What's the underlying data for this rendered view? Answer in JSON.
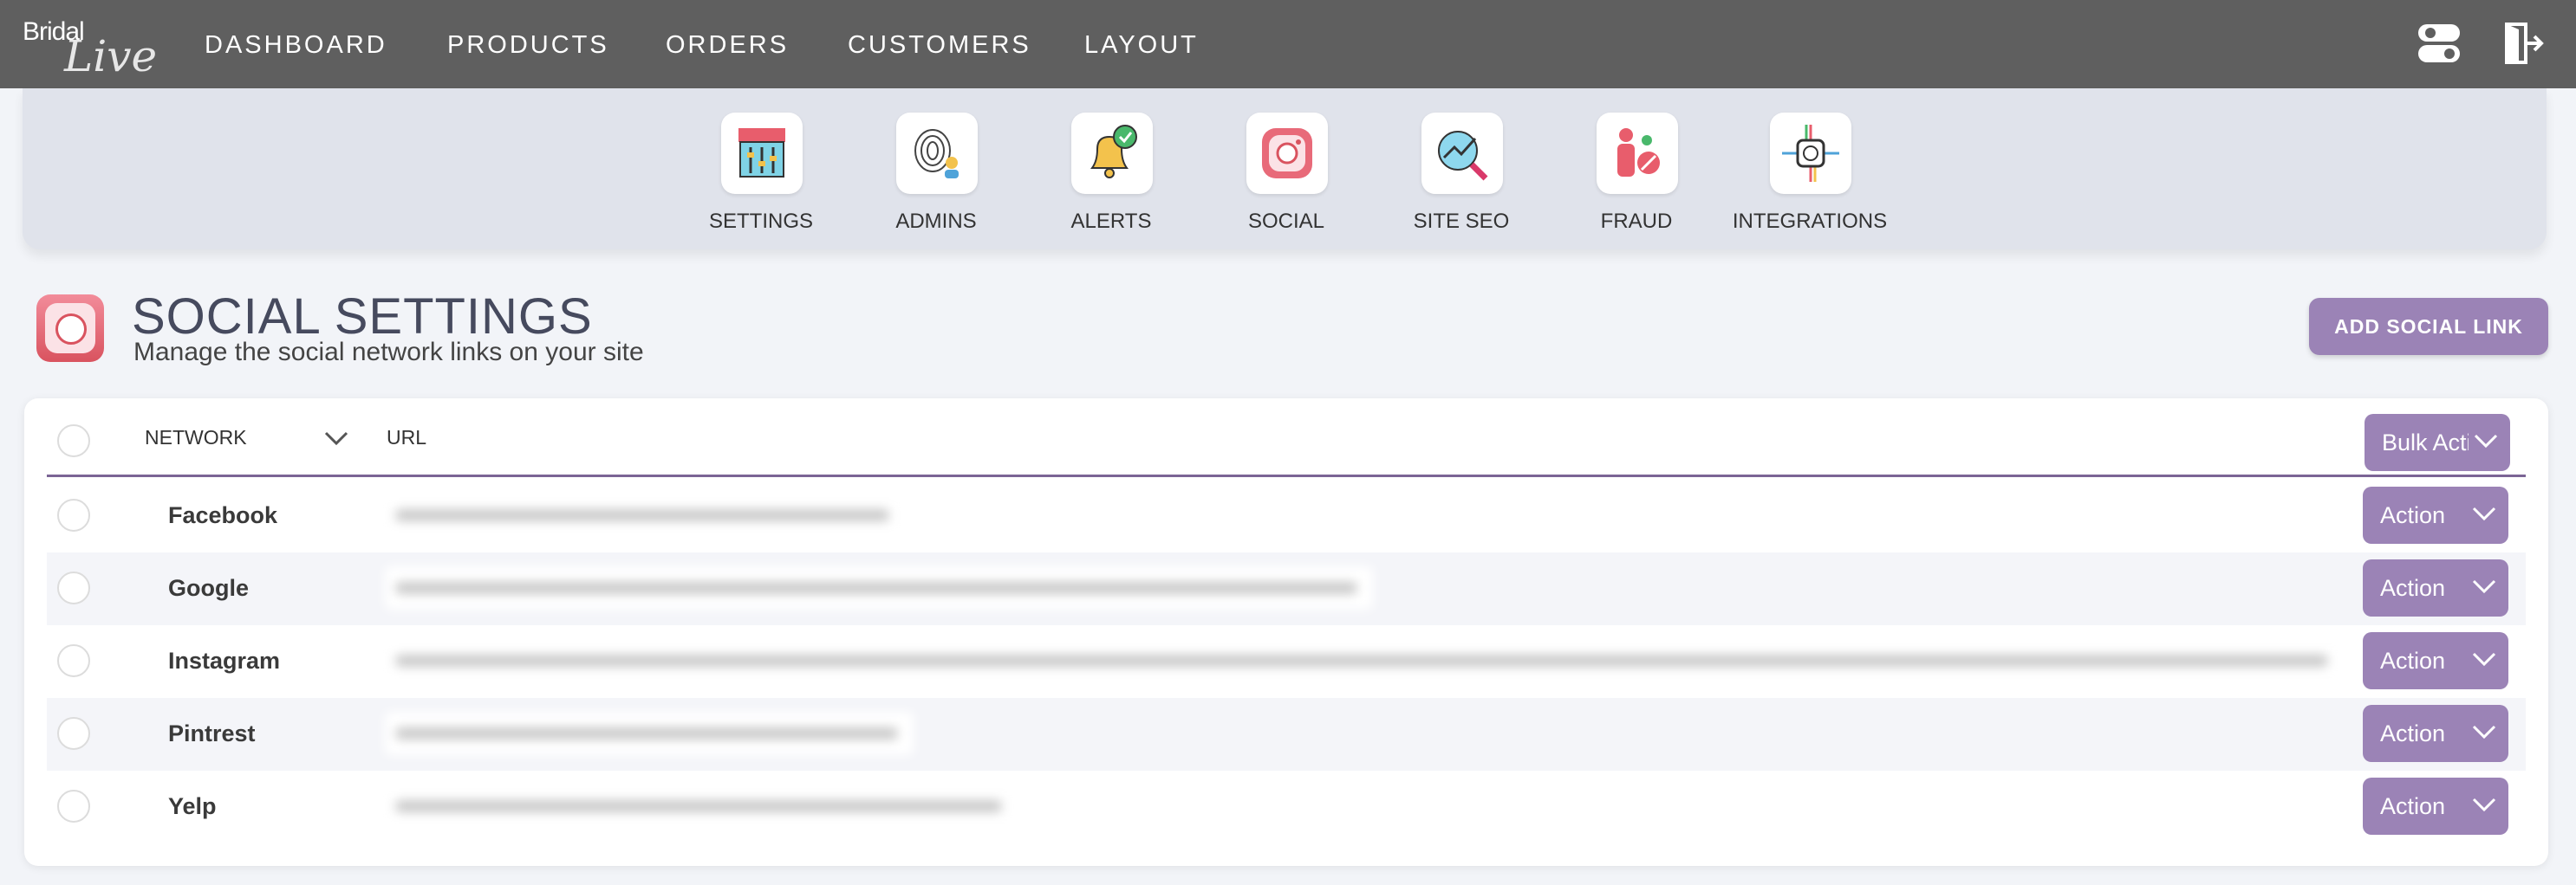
{
  "app": {
    "logo_text_1": "Bridal",
    "logo_text_2": "Live"
  },
  "nav": {
    "items": [
      "DASHBOARD",
      "PRODUCTS",
      "ORDERS",
      "CUSTOMERS",
      "LAYOUT"
    ]
  },
  "settings_tiles": [
    {
      "label": "SETTINGS",
      "icon": "storefront-settings-icon"
    },
    {
      "label": "ADMINS",
      "icon": "fingerprint-admin-icon"
    },
    {
      "label": "ALERTS",
      "icon": "bell-check-icon"
    },
    {
      "label": "SOCIAL",
      "icon": "instagram-icon"
    },
    {
      "label": "SITE SEO",
      "icon": "seo-magnifier-icon"
    },
    {
      "label": "FRAUD",
      "icon": "fraud-person-icon"
    },
    {
      "label": "INTEGRATIONS",
      "icon": "integrations-hub-icon"
    }
  ],
  "page": {
    "title": "SOCIAL SETTINGS",
    "subtitle": "Manage the social network links on your site",
    "add_button": "ADD SOCIAL LINK"
  },
  "table": {
    "columns": {
      "network": "NETWORK",
      "url": "URL"
    },
    "bulk_action": "Bulk Actions",
    "row_action": "Action",
    "rows": [
      {
        "network": "Facebook"
      },
      {
        "network": "Google"
      },
      {
        "network": "Instagram"
      },
      {
        "network": "Pintrest"
      },
      {
        "network": "Yelp"
      }
    ]
  },
  "colors": {
    "topbar": "#5f5f5f",
    "accent": "#9b83b6",
    "header_line": "#7b6495"
  }
}
